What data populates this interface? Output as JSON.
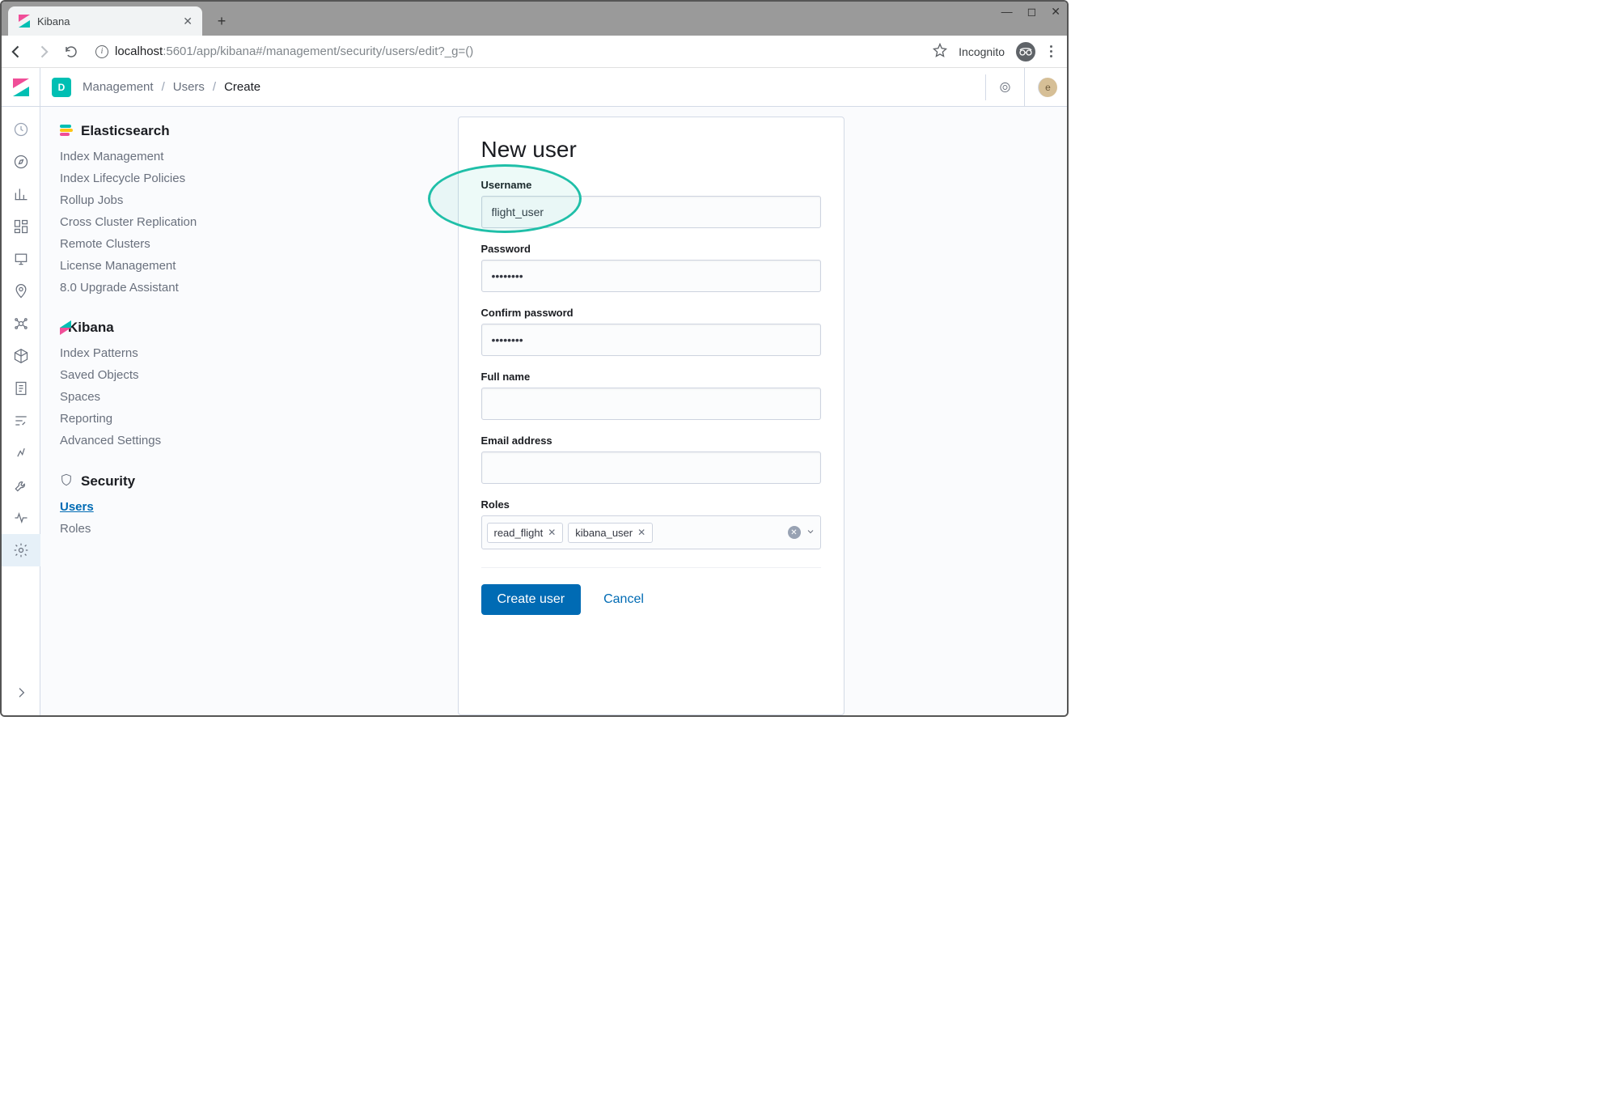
{
  "browser": {
    "tab_title": "Kibana",
    "url_host": "localhost",
    "url_port_path": ":5601/app/kibana#/management/security/users/edit?_g=()",
    "incognito_label": "Incognito"
  },
  "header": {
    "space_initial": "D",
    "breadcrumbs": [
      "Management",
      "Users",
      "Create"
    ],
    "user_initial": "e"
  },
  "mgmt_sidebar": {
    "sections": [
      {
        "title": "Elasticsearch",
        "icon": "es",
        "items": [
          "Index Management",
          "Index Lifecycle Policies",
          "Rollup Jobs",
          "Cross Cluster Replication",
          "Remote Clusters",
          "License Management",
          "8.0 Upgrade Assistant"
        ]
      },
      {
        "title": "Kibana",
        "icon": "kibana",
        "items": [
          "Index Patterns",
          "Saved Objects",
          "Spaces",
          "Reporting",
          "Advanced Settings"
        ]
      },
      {
        "title": "Security",
        "icon": "shield",
        "items": [
          "Users",
          "Roles"
        ],
        "active": "Users"
      }
    ]
  },
  "form": {
    "title": "New user",
    "labels": {
      "username": "Username",
      "password": "Password",
      "confirm_password": "Confirm password",
      "full_name": "Full name",
      "email": "Email address",
      "roles": "Roles"
    },
    "values": {
      "username": "flight_user",
      "password": "••••••••",
      "confirm_password": "••••••••",
      "full_name": "",
      "email": "",
      "roles": [
        "read_flight",
        "kibana_user"
      ]
    },
    "buttons": {
      "submit": "Create user",
      "cancel": "Cancel"
    }
  }
}
